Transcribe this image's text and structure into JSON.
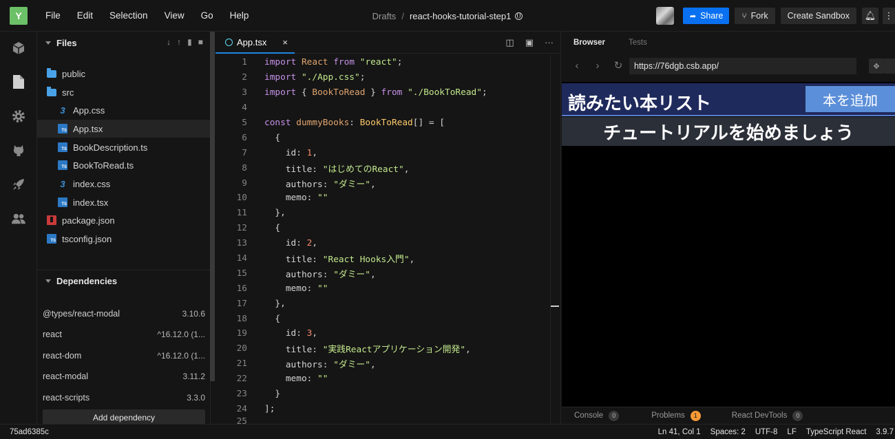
{
  "topbar": {
    "logo_letter": "Y",
    "menu": [
      "File",
      "Edit",
      "Selection",
      "View",
      "Go",
      "Help"
    ],
    "breadcrumb_drafts": "Drafts",
    "breadcrumb_sep": "/",
    "sandbox_name": "react-hooks-tutorial-step1",
    "share_label": "Share",
    "fork_label": "Fork",
    "create_label": "Create Sandbox"
  },
  "sidebar": {
    "files_title": "Files",
    "files": [
      {
        "name": "public",
        "icon": "folder-icon",
        "indent": 0
      },
      {
        "name": "src",
        "icon": "folder-open-icon",
        "indent": 0
      },
      {
        "name": "App.css",
        "icon": "css-file-icon",
        "indent": 1
      },
      {
        "name": "App.tsx",
        "icon": "ts-file-icon",
        "indent": 1,
        "active": true
      },
      {
        "name": "BookDescription.ts",
        "icon": "ts-file-icon",
        "indent": 1
      },
      {
        "name": "BookToRead.ts",
        "icon": "ts-file-icon",
        "indent": 1
      },
      {
        "name": "index.css",
        "icon": "css-file-icon",
        "indent": 1
      },
      {
        "name": "index.tsx",
        "icon": "ts-file-icon",
        "indent": 1
      },
      {
        "name": "package.json",
        "icon": "npm-package-icon",
        "indent": 0
      },
      {
        "name": "tsconfig.json",
        "icon": "ts-file-icon",
        "indent": 0
      }
    ],
    "deps_title": "Dependencies",
    "dependencies": [
      {
        "name": "@types/react-modal",
        "version": "3.10.6"
      },
      {
        "name": "react",
        "version": "^16.12.0 (1..."
      },
      {
        "name": "react-dom",
        "version": "^16.12.0 (1..."
      },
      {
        "name": "react-modal",
        "version": "3.11.2"
      },
      {
        "name": "react-scripts",
        "version": "3.3.0"
      }
    ],
    "add_dependency_label": "Add dependency"
  },
  "editor": {
    "tab_label": "App.tsx",
    "tab_close": "×",
    "line_numbers": [
      "1",
      "2",
      "3",
      "4",
      "5",
      "6",
      "7",
      "8",
      "9",
      "10",
      "11",
      "12",
      "13",
      "14",
      "15",
      "16",
      "17",
      "18",
      "19",
      "20",
      "21",
      "22",
      "23",
      "24",
      "25"
    ]
  },
  "browser": {
    "tabs": [
      "Browser",
      "Tests"
    ],
    "url": "https://76dgb.csb.app/",
    "app_title": "読みたい本リスト",
    "add_book_label": "本を追加",
    "tutorial_text": "チュートリアルを始めましょう",
    "console_tabs": [
      {
        "label": "Console",
        "count": "0"
      },
      {
        "label": "Problems",
        "count": "1"
      },
      {
        "label": "React DevTools",
        "count": "0"
      }
    ]
  },
  "statusbar": {
    "commit": "75ad6385c",
    "position": "Ln 41, Col 1",
    "spaces": "Spaces: 2",
    "encoding": "UTF-8",
    "eol": "LF",
    "language": "TypeScript React",
    "version": "3.9.7"
  },
  "colors": {
    "accent": "#0971f1",
    "logo": "#6cc067",
    "warn_badge": "#f69935"
  }
}
